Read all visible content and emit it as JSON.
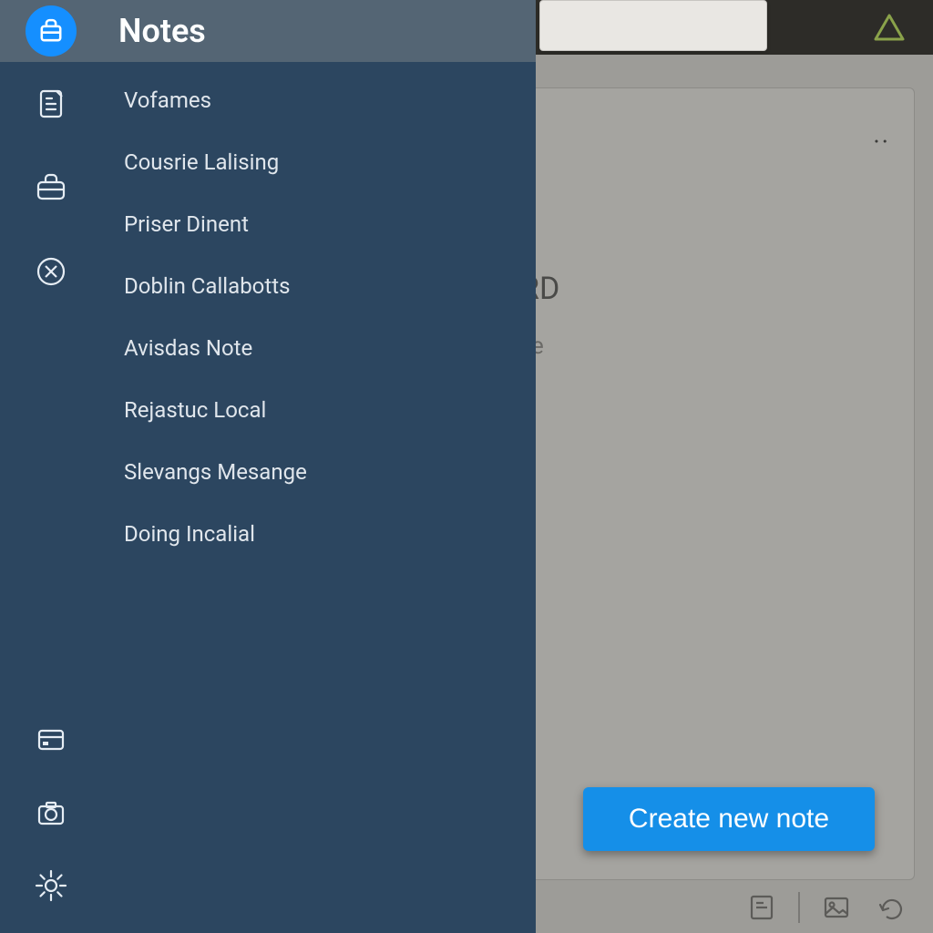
{
  "header": {
    "title": "Notes"
  },
  "drawer": {
    "items": [
      {
        "label": "Vofames"
      },
      {
        "label": "Cousrie Lalising"
      },
      {
        "label": "Priser Dinent"
      },
      {
        "label": "Doblin Callabotts"
      },
      {
        "label": "Avisdas Note"
      },
      {
        "label": "Rejastuc Local"
      },
      {
        "label": "Slevangs Mesange"
      },
      {
        "label": "Doing Incalial"
      }
    ]
  },
  "content": {
    "title_fragment": "RD",
    "subtitle_fragment": "e",
    "kebab": "··"
  },
  "actions": {
    "create_label": "Create new note"
  },
  "colors": {
    "accent": "#158fe8",
    "drawer_bg": "#2c4660",
    "drawer_header_bg": "#546574",
    "triangle": "#8aa24a"
  },
  "icons": {
    "app": "briefcase-icon",
    "rail_top": [
      "document-icon",
      "briefcase-outline-icon",
      "close-circle-icon"
    ],
    "rail_bottom": [
      "card-icon",
      "camera-icon",
      "gear-icon"
    ],
    "topbar": "triangle-icon",
    "content_toolbar": [
      "note-icon",
      "image-icon",
      "undo-icon"
    ]
  }
}
